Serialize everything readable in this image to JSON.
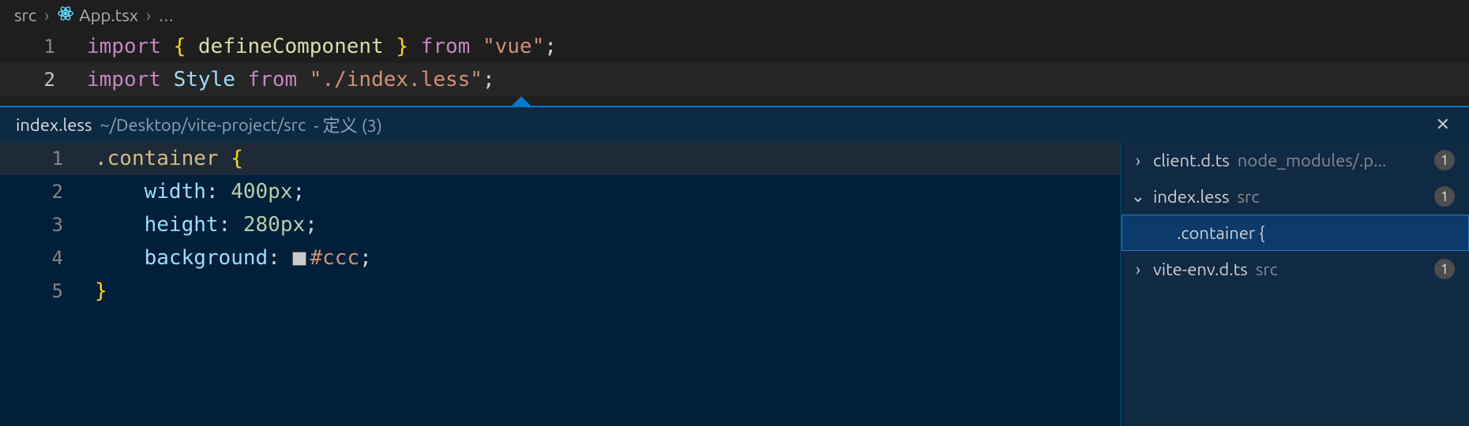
{
  "breadcrumb": {
    "items": [
      {
        "label": "src",
        "icon": null
      },
      {
        "label": "App.tsx",
        "icon": "react-icon"
      },
      {
        "label": "...",
        "icon": null
      }
    ]
  },
  "editor": {
    "lines": [
      {
        "n": "1",
        "tokens": [
          {
            "t": "import",
            "c": "kw"
          },
          {
            "t": " ",
            "c": ""
          },
          {
            "t": "{",
            "c": "brace"
          },
          {
            "t": " ",
            "c": ""
          },
          {
            "t": "defineComponent",
            "c": "fn"
          },
          {
            "t": " ",
            "c": ""
          },
          {
            "t": "}",
            "c": "brace"
          },
          {
            "t": " ",
            "c": ""
          },
          {
            "t": "from",
            "c": "kw"
          },
          {
            "t": " ",
            "c": ""
          },
          {
            "t": "\"vue\"",
            "c": "str"
          },
          {
            "t": ";",
            "c": "pun"
          }
        ]
      },
      {
        "n": "2",
        "active": true,
        "tokens": [
          {
            "t": "import",
            "c": "kw"
          },
          {
            "t": " ",
            "c": ""
          },
          {
            "t": "Style",
            "c": "var"
          },
          {
            "t": " ",
            "c": ""
          },
          {
            "t": "from",
            "c": "kw"
          },
          {
            "t": " ",
            "c": ""
          },
          {
            "t": "\"./index.less\"",
            "c": "str"
          },
          {
            "t": ";",
            "c": "pun"
          }
        ]
      }
    ]
  },
  "peek": {
    "header": {
      "file": "index.less",
      "path": "~/Desktop/vite-project/src",
      "suffix": "- 定义 (3)",
      "close_label": "✕"
    },
    "lines": [
      {
        "n": "1",
        "hl": true,
        "tokens": [
          {
            "t": ".container",
            "c": "sel"
          },
          {
            "t": " ",
            "c": ""
          },
          {
            "t": "{",
            "c": "brace"
          }
        ]
      },
      {
        "n": "2",
        "tokens": [
          {
            "t": "    ",
            "c": ""
          },
          {
            "t": "width",
            "c": "prop"
          },
          {
            "t": ":",
            "c": "pun"
          },
          {
            "t": " ",
            "c": ""
          },
          {
            "t": "400px",
            "c": "num"
          },
          {
            "t": ";",
            "c": "pun"
          }
        ]
      },
      {
        "n": "3",
        "tokens": [
          {
            "t": "    ",
            "c": ""
          },
          {
            "t": "height",
            "c": "prop"
          },
          {
            "t": ":",
            "c": "pun"
          },
          {
            "t": " ",
            "c": ""
          },
          {
            "t": "280px",
            "c": "num"
          },
          {
            "t": ";",
            "c": "pun"
          }
        ]
      },
      {
        "n": "4",
        "tokens": [
          {
            "t": "    ",
            "c": ""
          },
          {
            "t": "background",
            "c": "prop"
          },
          {
            "t": ":",
            "c": "pun"
          },
          {
            "t": " ",
            "c": ""
          },
          {
            "t": "__SWATCH__",
            "c": ""
          },
          {
            "t": "#ccc",
            "c": "hex"
          },
          {
            "t": ";",
            "c": "pun"
          }
        ]
      },
      {
        "n": "5",
        "tokens": [
          {
            "t": "}",
            "c": "brace"
          }
        ]
      }
    ],
    "refs": [
      {
        "icon": "chevron-right",
        "name": "client.d.ts",
        "path": "node_modules/.p...",
        "count": "1",
        "child": false,
        "selected": false
      },
      {
        "icon": "chevron-down",
        "name": "index.less",
        "path": "src",
        "count": "1",
        "child": false,
        "selected": false
      },
      {
        "icon": null,
        "name": ".container {",
        "path": "",
        "count": "",
        "child": true,
        "selected": true
      },
      {
        "icon": "chevron-right",
        "name": "vite-env.d.ts",
        "path": "src",
        "count": "1",
        "child": false,
        "selected": false
      }
    ]
  }
}
